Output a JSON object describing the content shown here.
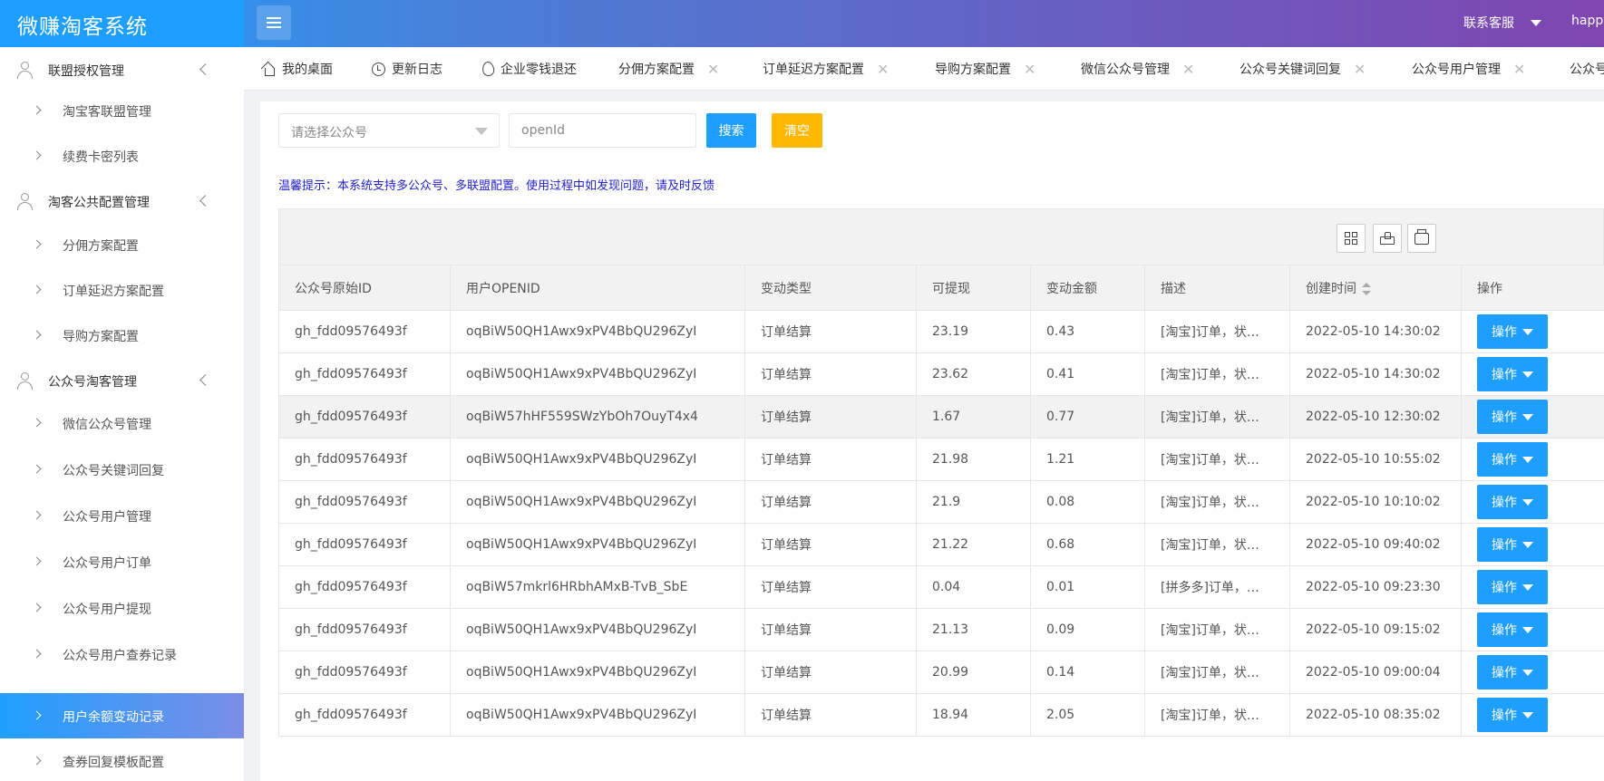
{
  "header": {
    "logo": "微赚淘客系统",
    "service": "联系客服",
    "user": "happy"
  },
  "sidebar": {
    "groups": [
      {
        "label": "联盟授权管理",
        "items": [
          "淘宝客联盟管理",
          "续费卡密列表"
        ]
      },
      {
        "label": "淘客公共配置管理",
        "items": [
          "分佣方案配置",
          "订单延迟方案配置",
          "导购方案配置"
        ]
      },
      {
        "label": "公众号淘客管理",
        "items": [
          "微信公众号管理",
          "公众号关键词回复",
          "公众号用户管理",
          "公众号用户订单",
          "公众号用户提现",
          "公众号用户查券记录",
          "用户余额变动记录",
          "查券回复模板配置"
        ]
      }
    ],
    "active": "用户余额变动记录"
  },
  "tabs": [
    "我的桌面",
    "更新日志",
    "企业零钱退还",
    "分佣方案配置",
    "订单延迟方案配置",
    "导购方案配置",
    "微信公众号管理",
    "公众号关键词回复",
    "公众号用户管理",
    "公众号"
  ],
  "toolbar": {
    "select_placeholder": "请选择公众号",
    "input_placeholder": "openId",
    "search": "搜索",
    "clear": "清空",
    "notice": "温馨提示：本系统支持多公众号、多联盟配置。使用过程中如发现问题，请及时反馈"
  },
  "table": {
    "columns": [
      "公众号原始ID",
      "用户OPENID",
      "变动类型",
      "可提现",
      "变动金额",
      "描述",
      "创建时间",
      "操作"
    ],
    "op_label": "操作",
    "rows": [
      [
        "gh_fdd09576493f",
        "oqBiW50QH1Awx9xPV4BbQU296ZyI",
        "订单结算",
        "23.19",
        "0.43",
        "[淘宝]订单，状…",
        "2022-05-10 14:30:02"
      ],
      [
        "gh_fdd09576493f",
        "oqBiW50QH1Awx9xPV4BbQU296ZyI",
        "订单结算",
        "23.62",
        "0.41",
        "[淘宝]订单，状…",
        "2022-05-10 14:30:02"
      ],
      [
        "gh_fdd09576493f",
        "oqBiW57hHF559SWzYbOh7OuyT4x4",
        "订单结算",
        "1.67",
        "0.77",
        "[淘宝]订单，状…",
        "2022-05-10 12:30:02"
      ],
      [
        "gh_fdd09576493f",
        "oqBiW50QH1Awx9xPV4BbQU296ZyI",
        "订单结算",
        "21.98",
        "1.21",
        "[淘宝]订单，状…",
        "2022-05-10 10:55:02"
      ],
      [
        "gh_fdd09576493f",
        "oqBiW50QH1Awx9xPV4BbQU296ZyI",
        "订单结算",
        "21.9",
        "0.08",
        "[淘宝]订单，状…",
        "2022-05-10 10:10:02"
      ],
      [
        "gh_fdd09576493f",
        "oqBiW50QH1Awx9xPV4BbQU296ZyI",
        "订单结算",
        "21.22",
        "0.68",
        "[淘宝]订单，状…",
        "2022-05-10 09:40:02"
      ],
      [
        "gh_fdd09576493f",
        "oqBiW57mkrl6HRbhAMxB-TvB_SbE",
        "订单结算",
        "0.04",
        "0.01",
        "[拼多多]订单，…",
        "2022-05-10 09:23:30"
      ],
      [
        "gh_fdd09576493f",
        "oqBiW50QH1Awx9xPV4BbQU296ZyI",
        "订单结算",
        "21.13",
        "0.09",
        "[淘宝]订单，状…",
        "2022-05-10 09:15:02"
      ],
      [
        "gh_fdd09576493f",
        "oqBiW50QH1Awx9xPV4BbQU296ZyI",
        "订单结算",
        "20.99",
        "0.14",
        "[淘宝]订单，状…",
        "2022-05-10 09:00:04"
      ],
      [
        "gh_fdd09576493f",
        "oqBiW50QH1Awx9xPV4BbQU296ZyI",
        "订单结算",
        "18.94",
        "2.05",
        "[淘宝]订单，状…",
        "2022-05-10 08:35:02"
      ]
    ]
  }
}
